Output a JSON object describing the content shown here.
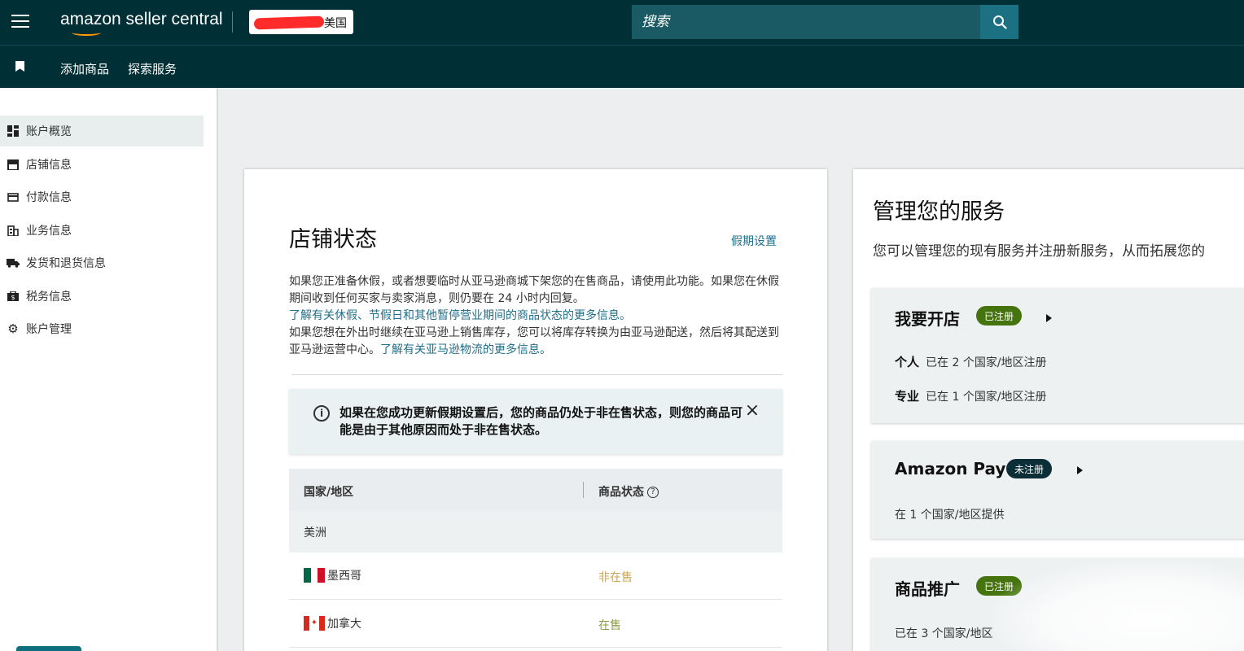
{
  "header": {
    "logo_text": "amazon seller central",
    "marketplace_visible": "美国",
    "search_placeholder": "搜索",
    "colors": {
      "topbar": "#002f36",
      "search": "#195a64",
      "search_button": "#1b7181"
    }
  },
  "nav": {
    "links": [
      "添加商品",
      "探索服务"
    ]
  },
  "sidebar": {
    "items": [
      {
        "label": "账户概览",
        "icon": "dashboard-icon"
      },
      {
        "label": "店铺信息",
        "icon": "store-icon"
      },
      {
        "label": "付款信息",
        "icon": "credit-card-icon"
      },
      {
        "label": "业务信息",
        "icon": "building-icon"
      },
      {
        "label": "发货和退货信息",
        "icon": "truck-icon"
      },
      {
        "label": "税务信息",
        "icon": "tax-icon"
      },
      {
        "label": "账户管理",
        "icon": "gear-icon"
      }
    ],
    "active_index": 0
  },
  "store_status": {
    "title": "店铺状态",
    "vacation_link": "假期设置",
    "para1": "如果您正准备休假，或者想要临时从亚马逊商城下架您的在售商品，请使用此功能。如果您在休假期间收到任何买家与卖家消息，则仍要在 24 小时内回复。",
    "para1_link": "了解有关休假、节假日和其他暂停营业期间的商品状态的更多信息。",
    "para2": "如果您想在外出时继续在亚马逊上销售库存，您可以将库存转换为由亚马逊配送，然后将其配送到亚马逊运营中心。",
    "para2_link": "了解有关亚马逊物流的更多信息。",
    "alert_text": "如果在您成功更新假期设置后，您的商品仍处于非在售状态，则您的商品可能是由于其他原因而处于非在售状态。",
    "table": {
      "col_country": "国家/地区",
      "col_status": "商品状态",
      "region": "美洲",
      "rows": [
        {
          "country": "墨西哥",
          "status": "非在售",
          "status_color": "#c9a65a"
        },
        {
          "country": "加拿大",
          "status": "在售",
          "status_color": "#8a9a4a"
        }
      ]
    }
  },
  "services": {
    "title": "管理您的服务",
    "subtitle": "您可以管理您的现有服务并注册新服务，从而拓展您的",
    "cards": [
      {
        "title": "我要开店",
        "badge": "已注册",
        "badge_color": "#45740e",
        "lines": [
          {
            "label": "个人",
            "text": "已在 2 个国家/地区注册"
          },
          {
            "label": "专业",
            "text": "已在 1 个国家/地区注册"
          }
        ]
      },
      {
        "title": "Amazon Pay",
        "badge": "未注册",
        "badge_color": "#0b2e37",
        "lines": [
          {
            "label": "",
            "text": "在 1 个国家/地区提供"
          }
        ]
      },
      {
        "title": "商品推广",
        "badge": "已注册",
        "badge_color": "#45740e",
        "lines": [
          {
            "label": "",
            "text": "已在 3 个国家/地区"
          }
        ]
      }
    ]
  }
}
